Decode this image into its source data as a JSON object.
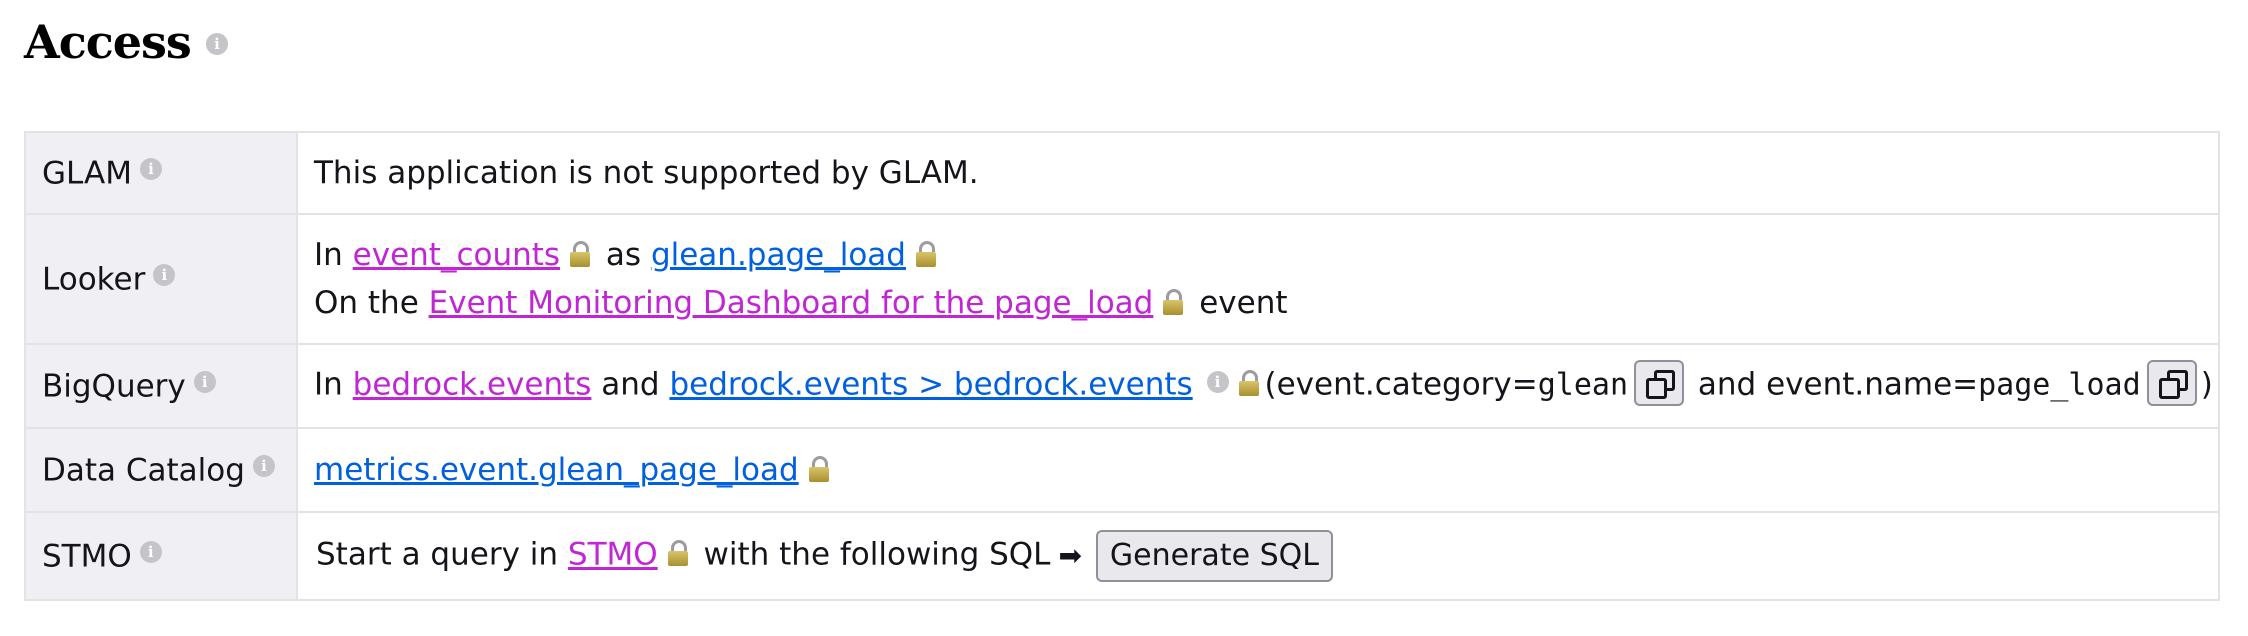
{
  "header": {
    "title": "Access"
  },
  "rows": {
    "glam": {
      "label": "GLAM",
      "text": "This application is not supported by GLAM."
    },
    "looker": {
      "label": "Looker",
      "line1": {
        "pre": "In",
        "link1": "event_counts",
        "mid": "as",
        "link2": "glean.page_load"
      },
      "line2": {
        "pre": "On the",
        "link": "Event Monitoring Dashboard for the page_load",
        "post": "event"
      }
    },
    "bigquery": {
      "label": "BigQuery",
      "pre": "In",
      "link1": "bedrock.events",
      "and": "and",
      "link2": "bedrock.events > bedrock.events",
      "cond1_pre": "(event.category=",
      "cond1_val": "glean",
      "cond2_pre": "and event.name=",
      "cond2_val": "page_load",
      "close": ")"
    },
    "data_catalog": {
      "label": "Data Catalog",
      "link": "metrics.event.glean_page_load"
    },
    "stmo": {
      "label": "STMO",
      "pre": "Start a query in",
      "link": "STMO",
      "post": "with the following SQL",
      "arrow": "➡",
      "button": "Generate SQL"
    }
  },
  "colors": {
    "link_purple": "#c026d3",
    "link_blue": "#0060df",
    "label_bg": "#f0f0f4",
    "border": "#e3e3e6"
  },
  "icons": [
    "info-icon",
    "lock-icon",
    "copy-icon",
    "arrow-right-icon"
  ]
}
